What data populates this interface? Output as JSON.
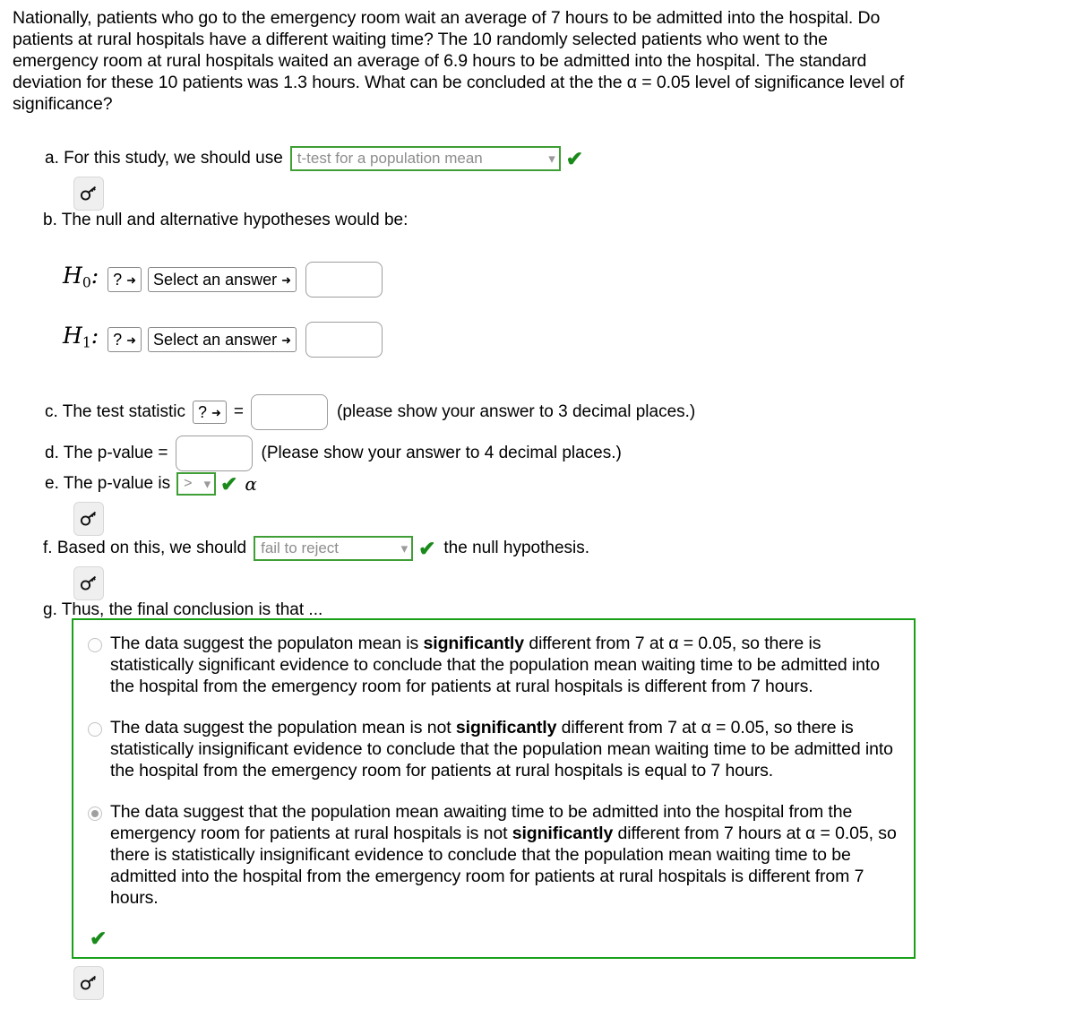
{
  "problem": {
    "text": "Nationally, patients who go to the emergency room wait an average of 7 hours to be admitted into the hospital. Do patients at rural hospitals have a different waiting time? The 10 randomly selected patients who went to the emergency room at rural hospitals waited an average of 6.9 hours to be admitted into the hospital. The standard deviation for these 10 patients was 1.3 hours. What can be concluded at the the α = 0.05 level of significance level of significance?"
  },
  "parts": {
    "a": {
      "label": "a. For this study, we should use",
      "select_value": "t-test for a population mean",
      "chevron": "chevron-down-icon",
      "check": "✔"
    },
    "b": {
      "label": "b. The null and alternative hypotheses would be:",
      "h0_label": "H",
      "h0_sub": "0",
      "h0_colon": ":",
      "h1_label": "H",
      "h1_sub": "1",
      "h1_colon": ":",
      "symbol_select": "?",
      "answer_select": "Select an answer",
      "value_input": ""
    },
    "c": {
      "label_before": "c. The test statistic",
      "symbol_select": "?",
      "equals": "=",
      "value_input": "",
      "hint": "(please show your answer to 3 decimal places.)"
    },
    "d": {
      "label": "d. The p-value =",
      "value_input": "",
      "hint": "(Please show your answer to 4 decimal places.)"
    },
    "e": {
      "label": "e. The p-value is",
      "comparison": ">",
      "check": "✔",
      "alpha": "α"
    },
    "f": {
      "label_before": "f. Based on this, we should",
      "select_value": "fail to reject",
      "check": "✔",
      "label_after": "the null hypothesis."
    },
    "g": {
      "label": "g. Thus, the final conclusion is that ...",
      "box_check": "✔",
      "options": [
        {
          "selected": false,
          "pre": "The data suggest the populaton mean is ",
          "bold": "significantly",
          "post": " different from 7 at α = 0.05, so there is statistically significant evidence to conclude that the population mean waiting time to be admitted into the hospital from the emergency room for patients at rural hospitals is different from 7 hours."
        },
        {
          "selected": false,
          "pre": "The data suggest the population mean is not ",
          "bold": "significantly",
          "post": " different from 7 at α = 0.05, so there is statistically insignificant evidence to conclude that the population mean waiting time to be admitted into the hospital from the emergency room for patients at rural hospitals is equal to 7 hours."
        },
        {
          "selected": true,
          "pre": "The data suggest that the population mean awaiting time to be admitted into the hospital from the emergency room for patients at rural hospitals is not ",
          "bold": "significantly",
          "post": " different from 7 hours at α = 0.05, so there is statistically insignificant evidence to conclude that the population mean waiting time to be admitted into the hospital from the emergency room for patients at rural hospitals is different from 7 hours."
        }
      ]
    }
  },
  "icons": {
    "key": "key-icon",
    "chevron": "⌄",
    "chevron_bold": "❮"
  },
  "colors": {
    "answered_green": "#3f9e35",
    "box_green": "#19a019",
    "check_green": "#1a8a1a",
    "placeholder_gray": "#8d8d8d"
  }
}
